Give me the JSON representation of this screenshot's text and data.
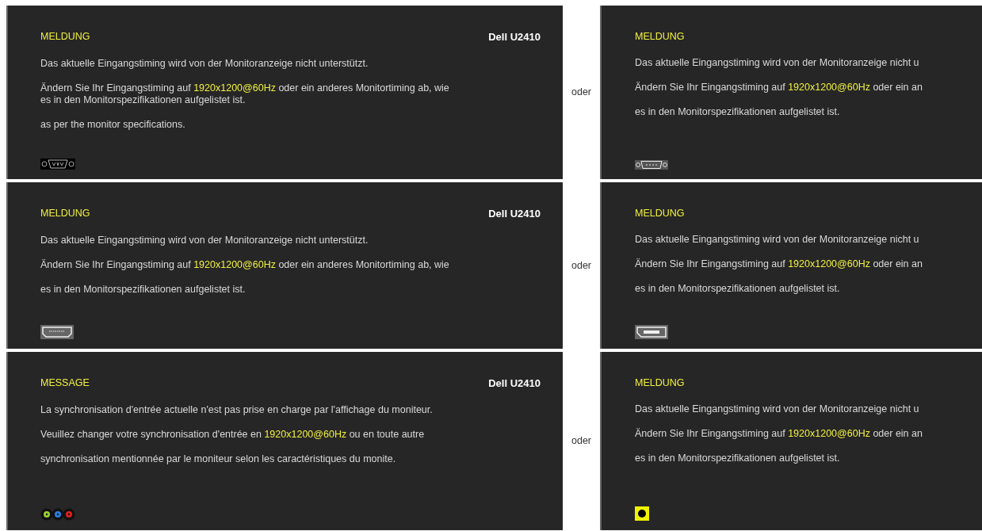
{
  "rows": [
    {
      "left": {
        "title": "MELDUNG",
        "model": "Dell U2410",
        "kind": "vga",
        "paragraphs": [
          [
            [
              {
                "text": "Das aktuelle Eingangstiming wird von der Monitoranzeige nicht unterstützt.",
                "highlight": false
              }
            ]
          ],
          [
            [
              {
                "text": "Ändern Sie Ihr Eingangstiming auf ",
                "highlight": false
              },
              {
                "text": "1920x1200@60Hz",
                "highlight": true
              },
              {
                "text": " oder ein anderes Monitortiming ab, wie",
                "highlight": false
              }
            ],
            [
              {
                "text": "es in den Monitorspezifikationen aufgelistet ist.",
                "highlight": false
              }
            ]
          ],
          [
            [
              {
                "text": "as per the monitor specifications.",
                "highlight": false
              }
            ]
          ]
        ]
      },
      "separator": "oder",
      "right": {
        "title": "MELDUNG",
        "kind": "dvi",
        "paragraphs": [
          [
            [
              {
                "text": "Das aktuelle Eingangstiming wird von der Monitoranzeige nicht u",
                "highlight": false
              }
            ]
          ],
          [
            [
              {
                "text": "Ändern Sie Ihr Eingangstiming auf ",
                "highlight": false
              },
              {
                "text": "1920x1200@60Hz",
                "highlight": true
              },
              {
                "text": " oder ein an",
                "highlight": false
              }
            ]
          ],
          [
            [
              {
                "text": "es in den Monitorspezifikationen aufgelistet ist.",
                "highlight": false
              }
            ]
          ]
        ]
      }
    },
    {
      "left": {
        "title": "MELDUNG",
        "model": "Dell U2410",
        "kind": "hdmi",
        "paragraphs": [
          [
            [
              {
                "text": "Das aktuelle Eingangstiming wird von der Monitoranzeige nicht unterstützt.",
                "highlight": false
              }
            ]
          ],
          [
            [
              {
                "text": "Ändern Sie Ihr Eingangstiming auf ",
                "highlight": false
              },
              {
                "text": "1920x1200@60Hz",
                "highlight": true
              },
              {
                "text": " oder ein anderes Monitortiming ab, wie",
                "highlight": false
              }
            ]
          ],
          [
            [
              {
                "text": "es in den Monitorspezifikationen aufgelistet ist.",
                "highlight": false
              }
            ]
          ]
        ]
      },
      "separator": "oder",
      "right": {
        "title": "MELDUNG",
        "kind": "displayport",
        "paragraphs": [
          [
            [
              {
                "text": "Das aktuelle Eingangstiming wird von der Monitoranzeige nicht u",
                "highlight": false
              }
            ]
          ],
          [
            [
              {
                "text": "Ändern Sie Ihr Eingangstiming auf ",
                "highlight": false
              },
              {
                "text": "1920x1200@60Hz",
                "highlight": true
              },
              {
                "text": " oder ein an",
                "highlight": false
              }
            ]
          ],
          [
            [
              {
                "text": "es in den Monitorspezifikationen aufgelistet ist.",
                "highlight": false
              }
            ]
          ]
        ]
      }
    },
    {
      "left": {
        "title": "MESSAGE",
        "model": "Dell U2410",
        "kind": "component",
        "paragraphs": [
          [
            [
              {
                "text": "La synchronisation d'entrée actuelle n'est pas prise en charge par l'affichage du moniteur.",
                "highlight": false
              }
            ]
          ],
          [
            [
              {
                "text": "Veuillez changer votre synchronisation d'entrée en ",
                "highlight": false
              },
              {
                "text": "1920x1200@60Hz",
                "highlight": true
              },
              {
                "text": " ou en toute autre",
                "highlight": false
              }
            ]
          ],
          [
            [
              {
                "text": "synchronisation mentionnée par le moniteur selon les caractéristiques du monite.",
                "highlight": false
              }
            ]
          ]
        ]
      },
      "separator": "oder",
      "right": {
        "title": "MELDUNG",
        "kind": "composite",
        "paragraphs": [
          [
            [
              {
                "text": "Das aktuelle Eingangstiming wird von der Monitoranzeige nicht u",
                "highlight": false
              }
            ]
          ],
          [
            [
              {
                "text": "Ändern Sie Ihr Eingangstiming auf ",
                "highlight": false
              },
              {
                "text": "1920x1200@60Hz",
                "highlight": true
              },
              {
                "text": " oder ein an",
                "highlight": false
              }
            ]
          ],
          [
            [
              {
                "text": "es in den Monitorspezifikationen aufgelistet ist.",
                "highlight": false
              }
            ]
          ]
        ]
      }
    }
  ]
}
